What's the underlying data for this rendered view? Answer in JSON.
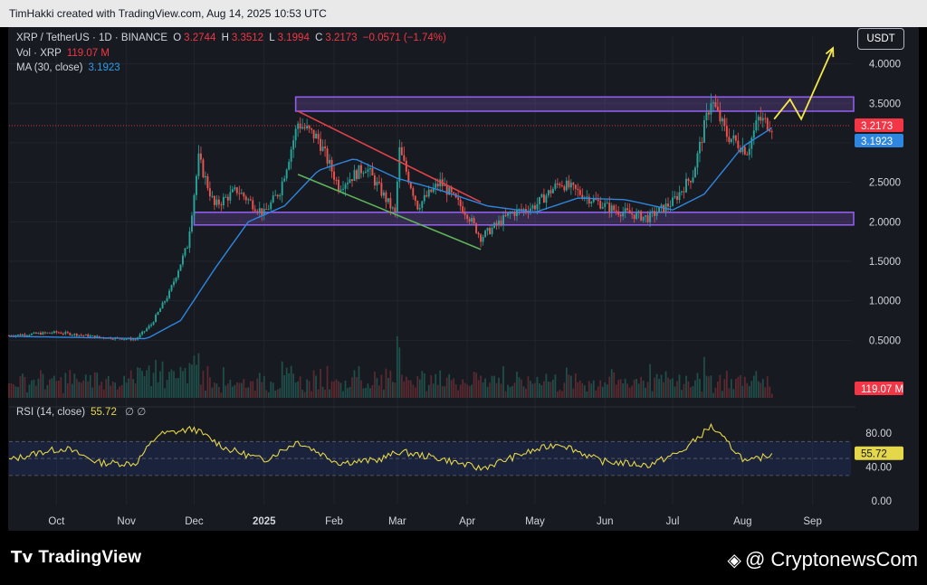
{
  "header": {
    "credit": "TimHakki created with TradingView.com, Aug 14, 2025 10:53 UTC"
  },
  "legend": {
    "symbol": "XRP / TetherUS · 1D · BINANCE",
    "open_label": "O",
    "open": "3.2744",
    "high_label": "H",
    "high": "3.3512",
    "low_label": "L",
    "low": "3.1994",
    "close_label": "C",
    "close": "3.2173",
    "change": "−0.0571 (−1.74%)",
    "vol_label": "Vol · XRP",
    "vol": "119.07 M",
    "ma_label": "MA (30, close)",
    "ma": "3.1923",
    "rsi_label": "RSI (14, close)",
    "rsi": "55.72",
    "rsi_extra": "∅ ∅"
  },
  "currency_button": "USDT",
  "badges": {
    "price": "3.2173",
    "ma": "3.1923",
    "volume": "119.07 M",
    "rsi": "55.72"
  },
  "colors": {
    "bull": "#26a69a",
    "bear": "#ef5350",
    "ma": "#2e86de",
    "zone": "#7e57c2",
    "rsi": "#e5d74a",
    "trend_top": "#e0424a",
    "trend_bottom": "#5fb35a",
    "projection": "#f5e94a"
  },
  "chart_data": {
    "type": "candlestick",
    "x_ticks": [
      "Oct",
      "Nov",
      "Dec",
      "2025",
      "Feb",
      "Mar",
      "Apr",
      "May",
      "Jun",
      "Jul",
      "Aug",
      "Sep"
    ],
    "price_ticks": [
      "4.0000",
      "3.5000",
      "3.0000",
      "2.5000",
      "2.0000",
      "1.5000",
      "1.0000",
      "0.5000"
    ],
    "rsi_ticks": [
      "80.00",
      "40.00",
      "0.00"
    ],
    "ylim": [
      0.0,
      4.35
    ],
    "rsi_bands": [
      70,
      30
    ],
    "zones": [
      {
        "low": 3.4,
        "high": 3.58
      },
      {
        "low": 1.96,
        "high": 2.12
      }
    ],
    "trendline_top": [
      {
        "date": "2025-01-16",
        "value": 3.4
      },
      {
        "date": "2025-04-07",
        "value": 2.25
      }
    ],
    "trendline_bottom": [
      {
        "date": "2025-01-16",
        "value": 2.6
      },
      {
        "date": "2025-04-07",
        "value": 1.65
      }
    ],
    "projection": [
      {
        "date": "2025-08-15",
        "value": 3.3
      },
      {
        "date": "2025-08-22",
        "value": 3.55
      },
      {
        "date": "2025-08-27",
        "value": 3.3
      },
      {
        "date": "2025-09-10",
        "value": 4.2
      }
    ],
    "price_path": [
      {
        "date": "2024-09-10",
        "value": 0.56
      },
      {
        "date": "2024-10-01",
        "value": 0.6
      },
      {
        "date": "2024-10-20",
        "value": 0.54
      },
      {
        "date": "2024-11-05",
        "value": 0.51
      },
      {
        "date": "2024-11-12",
        "value": 0.7
      },
      {
        "date": "2024-11-20",
        "value": 1.1
      },
      {
        "date": "2024-11-28",
        "value": 1.7
      },
      {
        "date": "2024-12-03",
        "value": 2.8
      },
      {
        "date": "2024-12-10",
        "value": 2.2
      },
      {
        "date": "2024-12-20",
        "value": 2.4
      },
      {
        "date": "2025-01-01",
        "value": 2.1
      },
      {
        "date": "2025-01-08",
        "value": 2.4
      },
      {
        "date": "2025-01-16",
        "value": 3.25
      },
      {
        "date": "2025-01-25",
        "value": 3.05
      },
      {
        "date": "2025-02-03",
        "value": 2.45
      },
      {
        "date": "2025-02-15",
        "value": 2.7
      },
      {
        "date": "2025-02-28",
        "value": 2.1
      },
      {
        "date": "2025-03-02",
        "value": 2.9
      },
      {
        "date": "2025-03-10",
        "value": 2.2
      },
      {
        "date": "2025-03-20",
        "value": 2.5
      },
      {
        "date": "2025-04-01",
        "value": 2.1
      },
      {
        "date": "2025-04-07",
        "value": 1.8
      },
      {
        "date": "2025-04-20",
        "value": 2.1
      },
      {
        "date": "2025-05-01",
        "value": 2.2
      },
      {
        "date": "2025-05-12",
        "value": 2.5
      },
      {
        "date": "2025-05-25",
        "value": 2.3
      },
      {
        "date": "2025-06-05",
        "value": 2.15
      },
      {
        "date": "2025-06-20",
        "value": 2.05
      },
      {
        "date": "2025-07-01",
        "value": 2.25
      },
      {
        "date": "2025-07-10",
        "value": 2.6
      },
      {
        "date": "2025-07-18",
        "value": 3.55
      },
      {
        "date": "2025-07-25",
        "value": 3.1
      },
      {
        "date": "2025-08-03",
        "value": 2.9
      },
      {
        "date": "2025-08-08",
        "value": 3.3
      },
      {
        "date": "2025-08-14",
        "value": 3.22
      }
    ],
    "ma30_path": [
      {
        "date": "2024-09-10",
        "value": 0.55
      },
      {
        "date": "2024-11-10",
        "value": 0.52
      },
      {
        "date": "2024-11-25",
        "value": 0.75
      },
      {
        "date": "2024-12-10",
        "value": 1.4
      },
      {
        "date": "2024-12-25",
        "value": 2.0
      },
      {
        "date": "2025-01-10",
        "value": 2.2
      },
      {
        "date": "2025-01-25",
        "value": 2.65
      },
      {
        "date": "2025-02-10",
        "value": 2.8
      },
      {
        "date": "2025-03-01",
        "value": 2.55
      },
      {
        "date": "2025-03-20",
        "value": 2.4
      },
      {
        "date": "2025-04-10",
        "value": 2.2
      },
      {
        "date": "2025-05-01",
        "value": 2.12
      },
      {
        "date": "2025-05-20",
        "value": 2.3
      },
      {
        "date": "2025-06-10",
        "value": 2.28
      },
      {
        "date": "2025-07-01",
        "value": 2.15
      },
      {
        "date": "2025-07-15",
        "value": 2.35
      },
      {
        "date": "2025-08-01",
        "value": 2.95
      },
      {
        "date": "2025-08-14",
        "value": 3.19
      }
    ],
    "rsi_path": [
      {
        "date": "2024-09-10",
        "value": 48
      },
      {
        "date": "2024-09-25",
        "value": 58
      },
      {
        "date": "2024-10-05",
        "value": 62
      },
      {
        "date": "2024-10-20",
        "value": 45
      },
      {
        "date": "2024-11-05",
        "value": 44
      },
      {
        "date": "2024-11-15",
        "value": 78
      },
      {
        "date": "2024-12-01",
        "value": 85
      },
      {
        "date": "2024-12-15",
        "value": 62
      },
      {
        "date": "2025-01-01",
        "value": 48
      },
      {
        "date": "2025-01-16",
        "value": 70
      },
      {
        "date": "2025-02-03",
        "value": 45
      },
      {
        "date": "2025-02-20",
        "value": 48
      },
      {
        "date": "2025-03-02",
        "value": 58
      },
      {
        "date": "2025-03-20",
        "value": 50
      },
      {
        "date": "2025-04-07",
        "value": 38
      },
      {
        "date": "2025-04-25",
        "value": 55
      },
      {
        "date": "2025-05-12",
        "value": 68
      },
      {
        "date": "2025-05-30",
        "value": 47
      },
      {
        "date": "2025-06-20",
        "value": 42
      },
      {
        "date": "2025-07-05",
        "value": 58
      },
      {
        "date": "2025-07-18",
        "value": 88
      },
      {
        "date": "2025-08-03",
        "value": 45
      },
      {
        "date": "2025-08-14",
        "value": 55.72
      }
    ]
  },
  "footer": {
    "brand_left": "TradingView",
    "brand_right": "@ CryptonewsCom"
  }
}
